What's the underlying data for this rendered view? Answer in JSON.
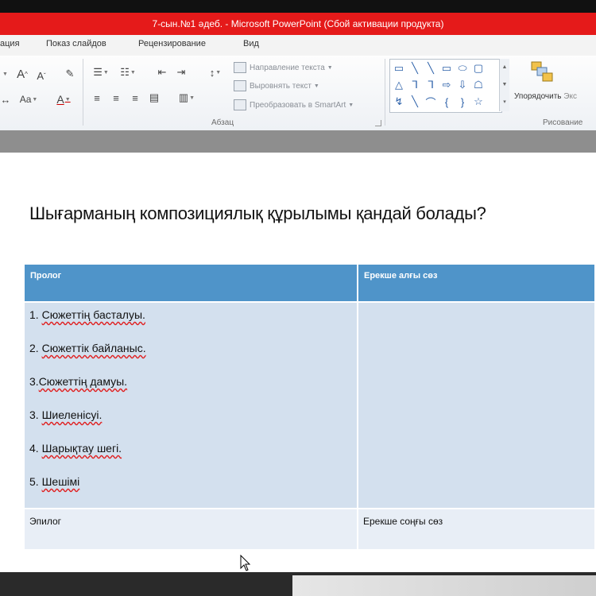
{
  "window": {
    "title": "7-сын.№1 әдеб. - Microsoft PowerPoint (Сбой активации продукта)"
  },
  "ribbon_tabs": [
    "ация",
    "Показ слайдов",
    "Рецензирование",
    "Вид"
  ],
  "ribbon": {
    "font_group": {
      "grow_font": "A",
      "shrink_font": "A",
      "change_case": "Aa",
      "font_color": "A"
    },
    "paragraph_group": {
      "label": "Абзац",
      "text_direction": "Направление текста",
      "align_text": "Выровнять текст",
      "convert_smartart": "Преобразовать в SmartArt"
    },
    "drawing_group": {
      "label": "Рисование",
      "arrange": "Упорядочить",
      "extra": "Экс"
    }
  },
  "slide": {
    "title": "Шығарманың композициялық  құрылымы қандай болады?",
    "table": {
      "headers": [
        "Пролог",
        "Ерекше алғы сөз"
      ],
      "items": [
        {
          "num": "1.  ",
          "text": "Сюжеттің басталуы."
        },
        {
          "num": "2. ",
          "text": "Сюжеттік байланыс."
        },
        {
          "num": "3.",
          "text": "Сюжеттің дамуы."
        },
        {
          "num": "3. ",
          "text": "Шиеленісуі."
        },
        {
          "num": "4. ",
          "text": "Шарықтау шегі."
        },
        {
          "num": "5. ",
          "text": "Шешімі"
        }
      ],
      "footer": [
        "Эпилог",
        "Ерекше соңғы сөз"
      ]
    }
  },
  "colors": {
    "title_bar": "#e51a1a",
    "table_header": "#4f94c9",
    "table_body": "#d3e0ee",
    "table_footer": "#e8eef6"
  }
}
